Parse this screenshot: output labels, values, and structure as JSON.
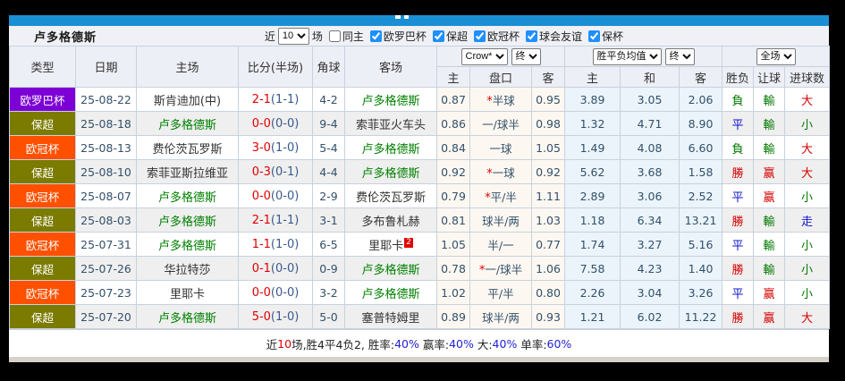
{
  "header": {
    "team_name": "卢多格德斯",
    "recent_label": "近",
    "recent_count": "10",
    "recent_suffix": "场",
    "filters": [
      {
        "label": "同主",
        "checked": false
      },
      {
        "label": "欧罗巴杯",
        "checked": true
      },
      {
        "label": "保超",
        "checked": true
      },
      {
        "label": "欧冠杯",
        "checked": true
      },
      {
        "label": "球会友谊",
        "checked": true
      },
      {
        "label": "保杯",
        "checked": true
      }
    ]
  },
  "dropdowns": {
    "bookmaker": "Crow*",
    "final_a": "终",
    "wdl_avg": "胜平负均值",
    "final_b": "终",
    "scope": "全场"
  },
  "table_header": {
    "col_type": "类型",
    "col_date": "日期",
    "col_home": "主场",
    "col_score": "比分(半场)",
    "col_corner": "角球",
    "col_away": "客场",
    "sub": [
      "主",
      "盘口",
      "客",
      "主",
      "和",
      "客",
      "胜负",
      "让球",
      "进球数"
    ]
  },
  "colors": {
    "europa_badge": "#7C00D5",
    "league_badge": "#7B7B00",
    "champions_badge": "#FF5000",
    "team_highlight": "#008000",
    "topbar_blue": "#1B8FD3",
    "win_red": "#D60000",
    "lose_green": "#007800",
    "draw_blue": "#1414D2"
  },
  "rows": [
    {
      "league": "欧罗巴杯",
      "league_class": "purple",
      "date": "25-08-22",
      "home": "斯肯迪加(中)",
      "home_class": "",
      "score": "2-1",
      "half": "(1-1)",
      "corner": "4-2",
      "away": "卢多格德斯",
      "away_class": "green",
      "away_badge": "",
      "odds_home": "0.87",
      "handicap_star": "*",
      "handicap": "半球",
      "odds_away": "0.95",
      "avg_home": "3.89",
      "avg_draw": "3.05",
      "avg_away": "2.06",
      "wdl": "負",
      "wdl_class": "resgreen",
      "hres": "輸",
      "hres_class": "resgreen",
      "ou": "大",
      "ou_class": "red"
    },
    {
      "league": "保超",
      "league_class": "olive",
      "date": "25-08-18",
      "home": "卢多格德斯",
      "home_class": "green",
      "score": "0-0",
      "half": "(0-0)",
      "corner": "9-4",
      "away": "索菲亚火车头",
      "away_class": "",
      "away_badge": "",
      "odds_home": "0.86",
      "handicap_star": "",
      "handicap": "一/球半",
      "odds_away": "0.98",
      "avg_home": "1.32",
      "avg_draw": "4.71",
      "avg_away": "8.90",
      "wdl": "平",
      "wdl_class": "blue",
      "hres": "輸",
      "hres_class": "resgreen",
      "ou": "小",
      "ou_class": "resgreen"
    },
    {
      "league": "欧冠杯",
      "league_class": "orange",
      "date": "25-08-13",
      "home": "费伦茨瓦罗斯",
      "home_class": "",
      "score": "3-0",
      "half": "(1-0)",
      "corner": "5-4",
      "away": "卢多格德斯",
      "away_class": "green",
      "away_badge": "",
      "odds_home": "0.84",
      "handicap_star": "",
      "handicap": "一球",
      "odds_away": "1.05",
      "avg_home": "1.49",
      "avg_draw": "4.08",
      "avg_away": "6.60",
      "wdl": "負",
      "wdl_class": "resgreen",
      "hres": "輸",
      "hres_class": "resgreen",
      "ou": "大",
      "ou_class": "red"
    },
    {
      "league": "保超",
      "league_class": "olive",
      "date": "25-08-10",
      "home": "索菲亚斯拉维亚",
      "home_class": "",
      "score": "0-3",
      "half": "(0-1)",
      "corner": "4-4",
      "away": "卢多格德斯",
      "away_class": "green",
      "away_badge": "",
      "odds_home": "0.92",
      "handicap_star": "*",
      "handicap": "一球",
      "odds_away": "0.92",
      "avg_home": "5.62",
      "avg_draw": "3.68",
      "avg_away": "1.58",
      "wdl": "勝",
      "wdl_class": "red",
      "hres": "赢",
      "hres_class": "red",
      "ou": "大",
      "ou_class": "red"
    },
    {
      "league": "欧冠杯",
      "league_class": "orange",
      "date": "25-08-07",
      "home": "卢多格德斯",
      "home_class": "green",
      "score": "0-0",
      "half": "(0-0)",
      "corner": "2-9",
      "away": "费伦茨瓦罗斯",
      "away_class": "",
      "away_badge": "",
      "odds_home": "0.79",
      "handicap_star": "*",
      "handicap": "平/半",
      "odds_away": "1.11",
      "avg_home": "2.89",
      "avg_draw": "3.06",
      "avg_away": "2.52",
      "wdl": "平",
      "wdl_class": "blue",
      "hres": "赢",
      "hres_class": "red",
      "ou": "小",
      "ou_class": "resgreen"
    },
    {
      "league": "保超",
      "league_class": "olive",
      "date": "25-08-03",
      "home": "卢多格德斯",
      "home_class": "green",
      "score": "2-1",
      "half": "(1-1)",
      "corner": "3-1",
      "away": "多布鲁札赫",
      "away_class": "",
      "away_badge": "",
      "odds_home": "0.81",
      "handicap_star": "",
      "handicap": "球半/两",
      "odds_away": "1.03",
      "avg_home": "1.18",
      "avg_draw": "6.34",
      "avg_away": "13.21",
      "wdl": "勝",
      "wdl_class": "red",
      "hres": "輸",
      "hres_class": "resgreen",
      "ou": "走",
      "ou_class": "blue"
    },
    {
      "league": "欧冠杯",
      "league_class": "orange",
      "date": "25-07-31",
      "home": "卢多格德斯",
      "home_class": "green",
      "score": "1-1",
      "half": "(1-0)",
      "corner": "6-5",
      "away": "里耶卡",
      "away_class": "",
      "away_badge": "2",
      "odds_home": "1.05",
      "handicap_star": "",
      "handicap": "半/一",
      "odds_away": "0.77",
      "avg_home": "1.74",
      "avg_draw": "3.27",
      "avg_away": "5.16",
      "wdl": "平",
      "wdl_class": "blue",
      "hres": "輸",
      "hres_class": "resgreen",
      "ou": "小",
      "ou_class": "resgreen"
    },
    {
      "league": "保超",
      "league_class": "olive",
      "date": "25-07-26",
      "home": "华拉特莎",
      "home_class": "",
      "score": "0-1",
      "half": "(0-0)",
      "corner": "0-9",
      "away": "卢多格德斯",
      "away_class": "green",
      "away_badge": "",
      "odds_home": "0.78",
      "handicap_star": "*",
      "handicap": "一/球半",
      "odds_away": "1.06",
      "avg_home": "7.58",
      "avg_draw": "4.23",
      "avg_away": "1.40",
      "wdl": "勝",
      "wdl_class": "red",
      "hres": "輸",
      "hres_class": "resgreen",
      "ou": "小",
      "ou_class": "resgreen"
    },
    {
      "league": "欧冠杯",
      "league_class": "orange",
      "date": "25-07-23",
      "home": "里耶卡",
      "home_class": "",
      "score": "0-0",
      "half": "(0-0)",
      "corner": "3-2",
      "away": "卢多格德斯",
      "away_class": "green",
      "away_badge": "",
      "odds_home": "1.02",
      "handicap_star": "",
      "handicap": "平/半",
      "odds_away": "0.80",
      "avg_home": "2.26",
      "avg_draw": "3.04",
      "avg_away": "3.26",
      "wdl": "平",
      "wdl_class": "blue",
      "hres": "赢",
      "hres_class": "red",
      "ou": "小",
      "ou_class": "resgreen"
    },
    {
      "league": "保超",
      "league_class": "olive",
      "date": "25-07-20",
      "home": "卢多格德斯",
      "home_class": "green",
      "score": "5-0",
      "half": "(1-0)",
      "corner": "5-0",
      "away": "塞普特姆里",
      "away_class": "",
      "away_badge": "",
      "odds_home": "0.89",
      "handicap_star": "",
      "handicap": "球半/两",
      "odds_away": "0.93",
      "avg_home": "1.21",
      "avg_draw": "6.02",
      "avg_away": "11.22",
      "wdl": "勝",
      "wdl_class": "red",
      "hres": "赢",
      "hres_class": "red",
      "ou": "大",
      "ou_class": "red"
    }
  ],
  "footer": {
    "segments": [
      {
        "text": "近",
        "color": ""
      },
      {
        "text": "10",
        "color": "red"
      },
      {
        "text": "场,胜4平4负2, 胜率:",
        "color": ""
      },
      {
        "text": "40%",
        "color": "blue"
      },
      {
        "text": " 赢率:",
        "color": ""
      },
      {
        "text": "40%",
        "color": "blue"
      },
      {
        "text": " 大:",
        "color": ""
      },
      {
        "text": "40%",
        "color": "blue"
      },
      {
        "text": " 单率:",
        "color": ""
      },
      {
        "text": "60%",
        "color": "blue"
      }
    ]
  }
}
